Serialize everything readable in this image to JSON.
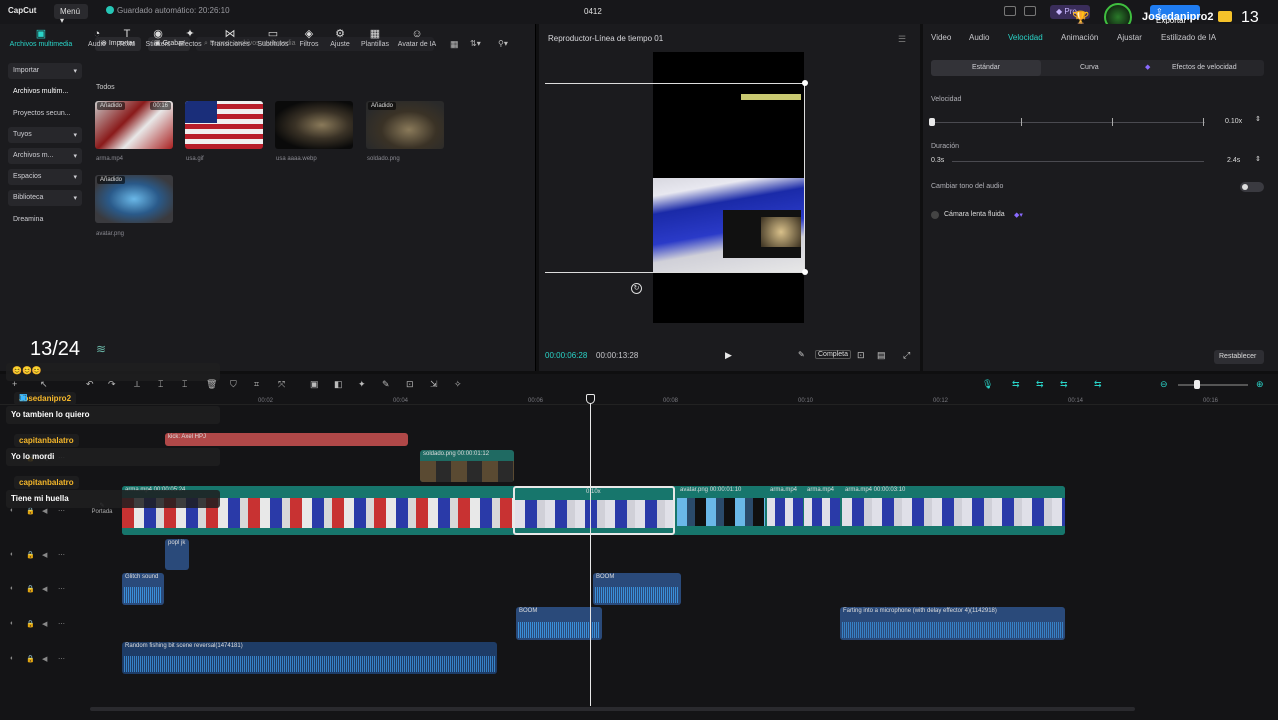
{
  "topbar": {
    "logo": "CapCut",
    "menu": "Menú",
    "autosave": "Guardado automático: 20:26:10",
    "project": "0412",
    "pro": "Pro",
    "export": "Exportar",
    "share": "rtir"
  },
  "tools": [
    {
      "label": "Archivos multimedia",
      "icon": "▣"
    },
    {
      "label": "Audio",
      "icon": "◔"
    },
    {
      "label": "Texto",
      "icon": "T"
    },
    {
      "label": "Stickers",
      "icon": "◉"
    },
    {
      "label": "Efectos",
      "icon": "✦"
    },
    {
      "label": "Transiciones",
      "icon": "⋈"
    },
    {
      "label": "Subtítulos",
      "icon": "▭"
    },
    {
      "label": "Filtros",
      "icon": "◈"
    },
    {
      "label": "Ajuste",
      "icon": "⚙"
    },
    {
      "label": "Plantillas",
      "icon": "▦"
    },
    {
      "label": "Avatar de IA",
      "icon": "☺"
    }
  ],
  "sidebar": {
    "items": [
      {
        "label": "Importar"
      },
      {
        "label": "Archivos multim..."
      },
      {
        "label": "Proyectos secun..."
      },
      {
        "label": "Tuyos"
      },
      {
        "label": "Archivos m..."
      },
      {
        "label": "Espacios"
      },
      {
        "label": "Biblioteca"
      },
      {
        "label": "Dreamina"
      }
    ]
  },
  "media": {
    "import": "Importar",
    "record": "Grabar",
    "search_placeholder": "Buscar archivos multimedia",
    "section": "Todos",
    "added": "Añadido",
    "items": [
      {
        "name": "arma.mp4",
        "duration": "00:16"
      },
      {
        "name": "usa.gif"
      },
      {
        "name": "usa aaaa.webp"
      },
      {
        "name": "soldado.png"
      },
      {
        "name": "avatar.png"
      }
    ]
  },
  "player": {
    "title": "Reproductor-Línea de tiempo 01",
    "time_current": "00:00:06:28",
    "time_total": "00:00:13:28",
    "full": "Completa"
  },
  "inspector": {
    "tabs": [
      "Video",
      "Audio",
      "Velocidad",
      "Animación",
      "Ajustar",
      "Estilizado de IA"
    ],
    "speed_modes": [
      "Estándar",
      "Curva",
      "Efectos de velocidad"
    ],
    "speed_label": "Velocidad",
    "speed_value": "0.10x",
    "duration_label": "Duración",
    "duration_start": "0.3s",
    "duration_value": "2.4s",
    "pitch_label": "Cambiar tono del audio",
    "smooth_label": "Cámara lenta fluida",
    "reset": "Restablecer"
  },
  "timeline": {
    "ruler": [
      "00:02",
      "00:04",
      "00:06",
      "00:08",
      "00:10",
      "00:12",
      "00:14",
      "00:16"
    ],
    "cover": "Portada",
    "clips": {
      "text_top": "kick: Axel HPJ",
      "soldado": "soldado.png  00:00:01:12",
      "arma_main": "arma.mp4  00:00:05:24",
      "speed_badge": "0.10x",
      "avatar": "avatar.png  00:00:01:10",
      "arma2": "arma.mp4",
      "arma3": "arma.mp4",
      "arma4": "arma.mp4  00:00:03:10",
      "popl": "popl jk",
      "glitch": "Glitch sound",
      "boom1": "BOOM",
      "boom2": "BOOM",
      "farting": "Farting into a microphone (with delay effector 4)(1142918)",
      "fishing": "Random fishing bit scene reversal(1474181)"
    }
  },
  "overlay": {
    "counter": "13/24",
    "corner_name": "Josedanipro2",
    "corner_count": "13",
    "emojis": "😊😊😊",
    "chat": [
      {
        "user": "Josedanipro2",
        "msg": "Yo tambien lo quiero",
        "color": "#f5b72a"
      },
      {
        "user": "capitanbalatro",
        "msg": "Yo lo mordi",
        "color": "#f5b72a"
      },
      {
        "user": "capitanbalatro",
        "msg": "Tiene mi huella",
        "color": "#f5b72a"
      }
    ]
  }
}
